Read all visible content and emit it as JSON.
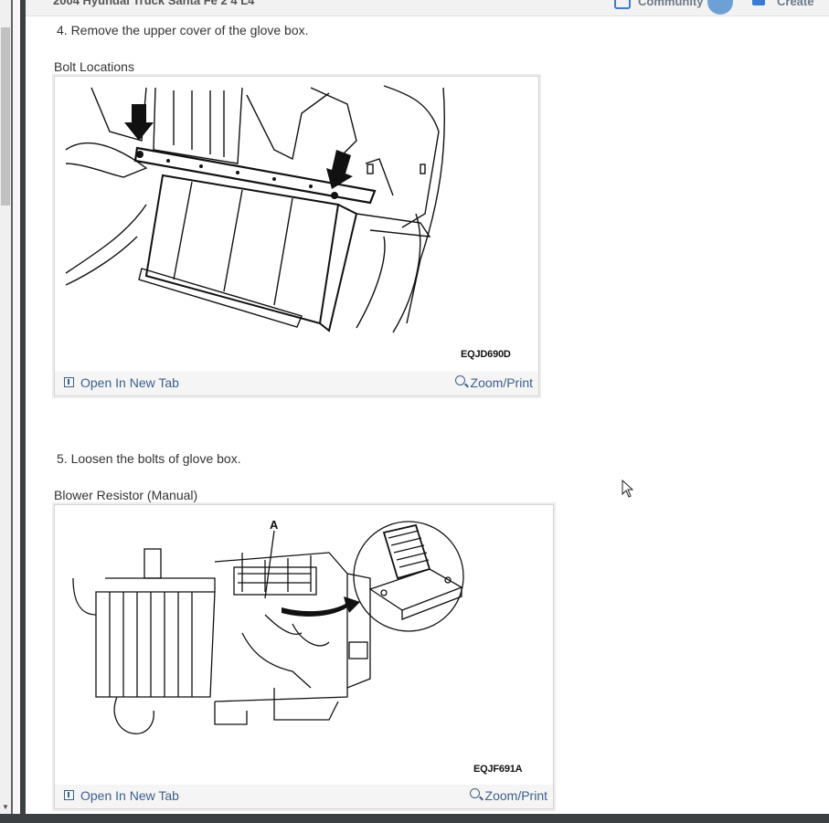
{
  "header": {
    "title": "2004 Hyundai Truck Santa Fe 2 4 L4",
    "community_label": "Community",
    "create_label": "Create"
  },
  "steps": [
    {
      "text": "4. Remove the upper cover of the glove box.",
      "figure_caption": "Bolt Locations",
      "figure_code": "EQJD690D",
      "open_label": "Open In New Tab",
      "zoom_label": "Zoom/Print"
    },
    {
      "text": "5. Loosen the bolts of glove box.",
      "figure_caption": "Blower Resistor (Manual)",
      "figure_code": "EQJF691A",
      "figure_callout": "A",
      "open_label": "Open In New Tab",
      "zoom_label": "Zoom/Print"
    }
  ],
  "icons": {
    "open_tab": "external-tab-icon",
    "zoom": "magnifier-zoom-icon",
    "cursor": "mouse-pointer-icon"
  },
  "colors": {
    "link": "#3d5f8a",
    "footer_bg": "#f5f5f5",
    "frame": "#3c4043"
  }
}
